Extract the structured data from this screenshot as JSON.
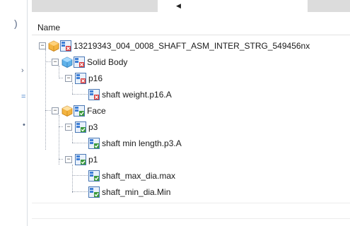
{
  "tree": {
    "header": "Name",
    "nodes": [
      {
        "label": "13219343_004_0008_SHAFT_ASM_INTER_STRG_549456nx",
        "status": "fail"
      },
      {
        "label": "Solid Body",
        "status": "fail"
      },
      {
        "label": "p16",
        "status": "fail"
      },
      {
        "label": "shaft weight.p16.A",
        "status": "fail"
      },
      {
        "label": "Face",
        "status": "pass"
      },
      {
        "label": "p3",
        "status": "pass"
      },
      {
        "label": "shaft min length.p3.A",
        "status": "pass"
      },
      {
        "label": "p1",
        "status": "pass"
      },
      {
        "label": "shaft_max_dia.max",
        "status": "pass"
      },
      {
        "label": "shaft_min_dia.Min",
        "status": "pass"
      }
    ]
  },
  "colors": {
    "fail": "#d83a3a",
    "pass": "#3c9a3c",
    "check_blue": "#3d7ed6",
    "cube_blue": "#4aa0e0",
    "cube_orange": "#f0a020"
  }
}
